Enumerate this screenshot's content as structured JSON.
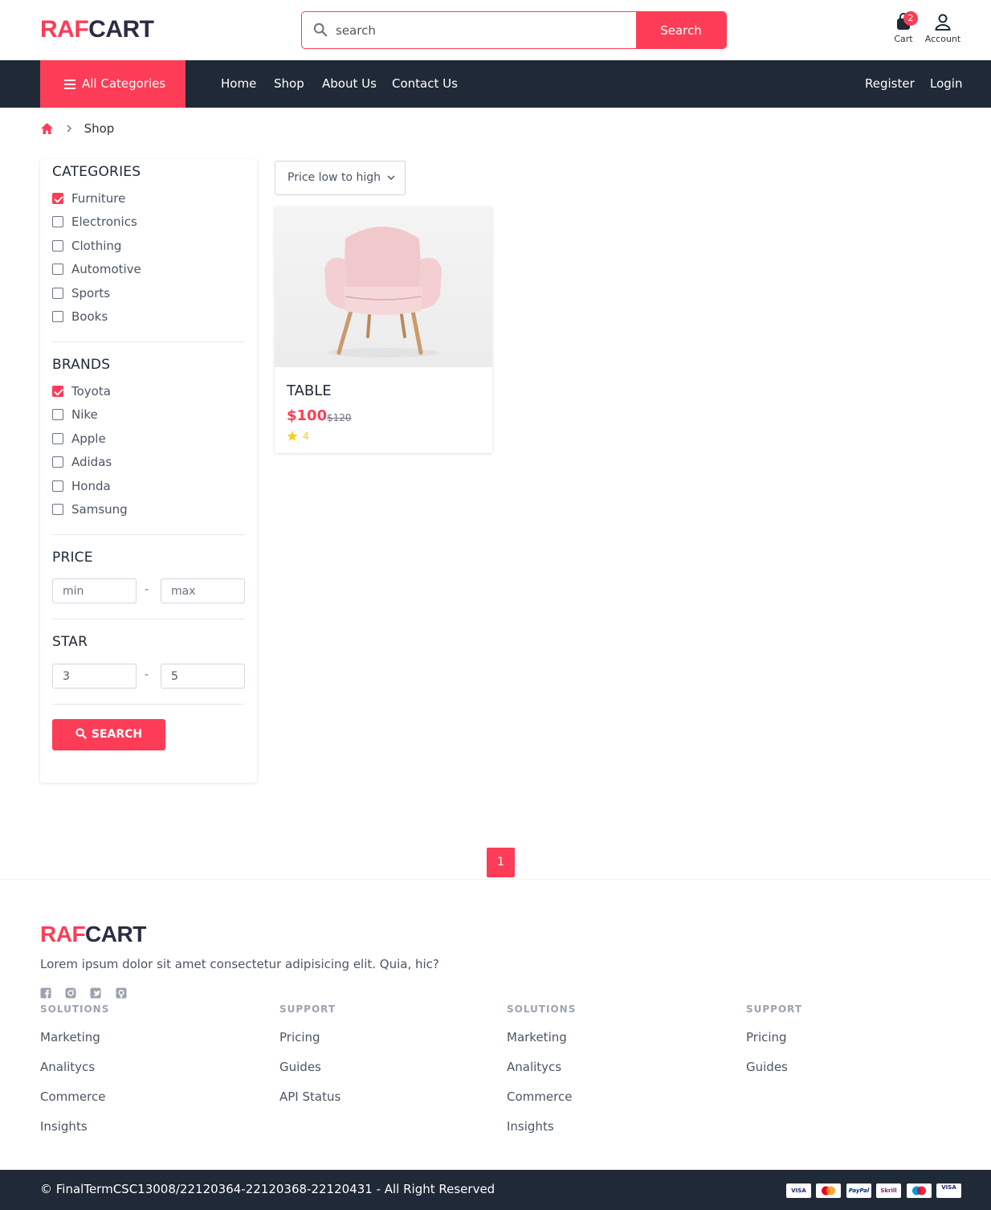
{
  "brand": {
    "logo_part1": "RAF",
    "logo_part2": "CART",
    "accent_color": "#fd3d57",
    "dark_color": "#1f2937"
  },
  "header": {
    "search_placeholder": "search",
    "search_button": "Search",
    "cart_label": "Cart",
    "cart_count": "2",
    "account_label": "Account"
  },
  "nav": {
    "all_categories": "All Categories",
    "links": [
      "Home",
      "Shop",
      "About Us",
      "Contact Us"
    ],
    "register": "Register",
    "login": "Login"
  },
  "breadcrumb": {
    "current": "Shop"
  },
  "sidebar": {
    "categories_title": "CATEGORIES",
    "categories": [
      {
        "label": "Furniture",
        "checked": true
      },
      {
        "label": "Electronics",
        "checked": false
      },
      {
        "label": "Clothing",
        "checked": false
      },
      {
        "label": "Automotive",
        "checked": false
      },
      {
        "label": "Sports",
        "checked": false
      },
      {
        "label": "Books",
        "checked": false
      }
    ],
    "brands_title": "BRANDS",
    "brands": [
      {
        "label": "Toyota",
        "checked": true
      },
      {
        "label": "Nike",
        "checked": false
      },
      {
        "label": "Apple",
        "checked": false
      },
      {
        "label": "Adidas",
        "checked": false
      },
      {
        "label": "Honda",
        "checked": false
      },
      {
        "label": "Samsung",
        "checked": false
      }
    ],
    "price_title": "PRICE",
    "price_min_placeholder": "min",
    "price_max_placeholder": "max",
    "star_title": "STAR",
    "star_min_value": "3",
    "star_max_value": "5",
    "dash": "-",
    "search_button": "SEARCH"
  },
  "sort": {
    "selected": "Price low to high"
  },
  "products": [
    {
      "title": "TABLE",
      "price": "$100",
      "old_price": "$120",
      "rating": "4"
    }
  ],
  "pagination": {
    "current_page": "1"
  },
  "footer": {
    "description": "Lorem ipsum dolor sit amet consectetur adipisicing elit. Quia, hic?",
    "social_icons": [
      "facebook-icon",
      "instagram-icon",
      "twitter-icon",
      "github-icon"
    ],
    "columns": [
      {
        "title": "SOLUTIONS",
        "links": [
          "Marketing",
          "Analitycs",
          "Commerce",
          "Insights"
        ]
      },
      {
        "title": "SUPPORT",
        "links": [
          "Pricing",
          "Guides",
          "API Status"
        ]
      },
      {
        "title": "SOLUTIONS",
        "links": [
          "Marketing",
          "Analitycs",
          "Commerce",
          "Insights"
        ]
      },
      {
        "title": "SUPPORT",
        "links": [
          "Pricing",
          "Guides"
        ]
      }
    ],
    "copyright": "© FinalTermCSC13008/22120364-22120368-22120431 - All Right Reserved",
    "payment_methods": [
      "VISA",
      "MC",
      "PayPal",
      "Skrill",
      "MC",
      "VISA"
    ]
  }
}
